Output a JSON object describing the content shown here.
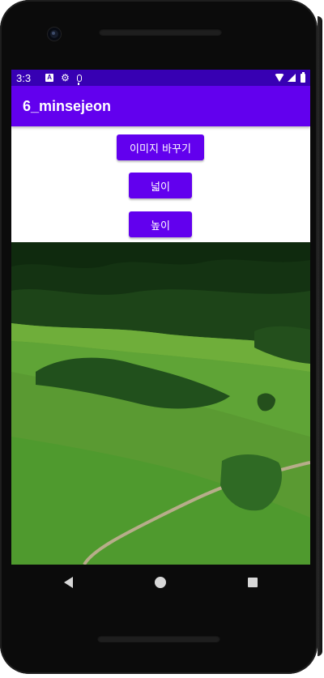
{
  "status_bar": {
    "time": "3:3",
    "icons": [
      "notification-a-icon",
      "settings-gear-icon",
      "mic-icon",
      "wifi-icon",
      "cell-signal-icon",
      "battery-icon"
    ]
  },
  "app_bar": {
    "title": "6_minsejeon"
  },
  "buttons": {
    "change_image": "이미지 바꾸기",
    "width": "넓이",
    "height": "높이"
  },
  "image": {
    "subject": "green-meadow-hillside"
  },
  "nav_bar": {
    "icons": [
      "back-icon",
      "home-icon",
      "recents-icon"
    ]
  },
  "colors": {
    "status_bar": "#3700b3",
    "app_bar": "#6200ee",
    "button": "#6200ee",
    "button_text": "#ffffff"
  }
}
